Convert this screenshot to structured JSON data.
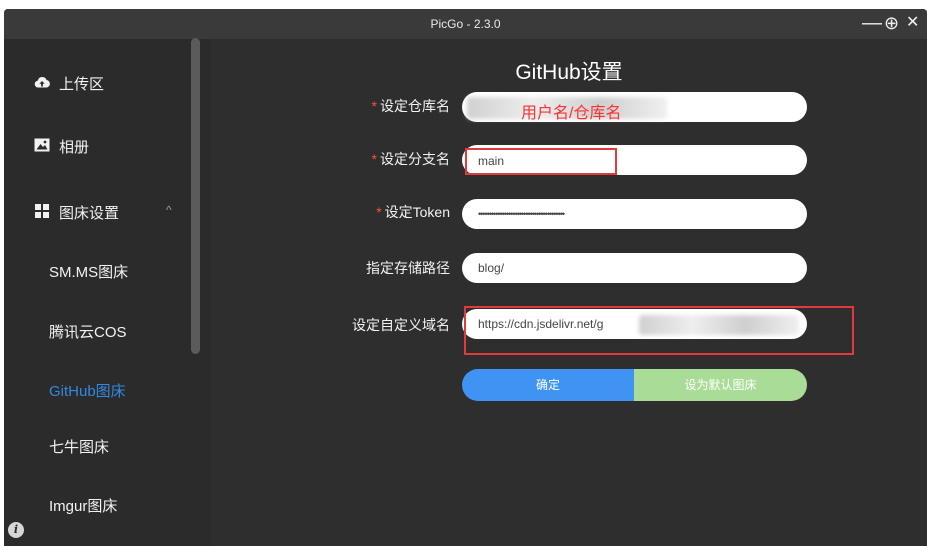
{
  "window": {
    "title": "PicGo - 2.3.0"
  },
  "controls": {
    "minimize": "—",
    "maximize": "⊕",
    "close": "✕"
  },
  "sidebar": {
    "items": [
      {
        "label": "上传区",
        "icon": "cloud-upload-icon"
      },
      {
        "label": "相册",
        "icon": "image-icon"
      },
      {
        "label": "图床设置",
        "icon": "grid-icon"
      }
    ],
    "collapse_glyph": "^",
    "subitems": [
      {
        "label": "SM.MS图床",
        "active": false
      },
      {
        "label": "腾讯云COS",
        "active": false
      },
      {
        "label": "GitHub图床",
        "active": true
      },
      {
        "label": "七牛图床",
        "active": false
      },
      {
        "label": "Imgur图床",
        "active": false
      }
    ],
    "info_glyph": "i"
  },
  "form": {
    "title": "GitHub设置",
    "required_mark": "*",
    "fields": [
      {
        "label": "设定仓库名",
        "required": true,
        "value": "",
        "annotation": "用户名/仓库名"
      },
      {
        "label": "设定分支名",
        "required": true,
        "value": "main"
      },
      {
        "label": "设定Token",
        "required": true,
        "value": "••••••••••••••••••••••••••••••••••••••••"
      },
      {
        "label": "指定存储路径",
        "required": false,
        "value": "blog/"
      },
      {
        "label": "设定自定义域名",
        "required": false,
        "value": "https://cdn.jsdelivr.net/g"
      }
    ],
    "buttons": {
      "confirm": "确定",
      "set_default": "设为默认图床"
    }
  },
  "colors": {
    "background": "#2e2e2e",
    "active_link": "#2f8ae0",
    "required": "#f2552c",
    "confirm_button": "#3f93f2",
    "default_button": "#a9dc96",
    "annotation": "#ff3030"
  }
}
